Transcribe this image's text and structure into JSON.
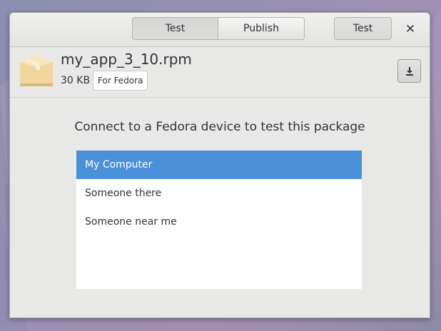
{
  "headerbar": {
    "segments": [
      {
        "label": "Test",
        "active": true
      },
      {
        "label": "Publish",
        "active": false
      }
    ],
    "test_button": "Test",
    "close_glyph": "✕"
  },
  "package": {
    "filename": "my_app_3_10.rpm",
    "size": "30 KB",
    "badge": "For Fedora",
    "icon": "package-box-icon"
  },
  "download_icon": "download-icon",
  "prompt": "Connect to a Fedora device to test this package",
  "devices": [
    {
      "label": "My Computer",
      "selected": true
    },
    {
      "label": "Someone there",
      "selected": false
    },
    {
      "label": "Someone near me",
      "selected": false
    }
  ],
  "colors": {
    "selection": "#4a90d9",
    "window_bg": "#e8e8e7"
  }
}
